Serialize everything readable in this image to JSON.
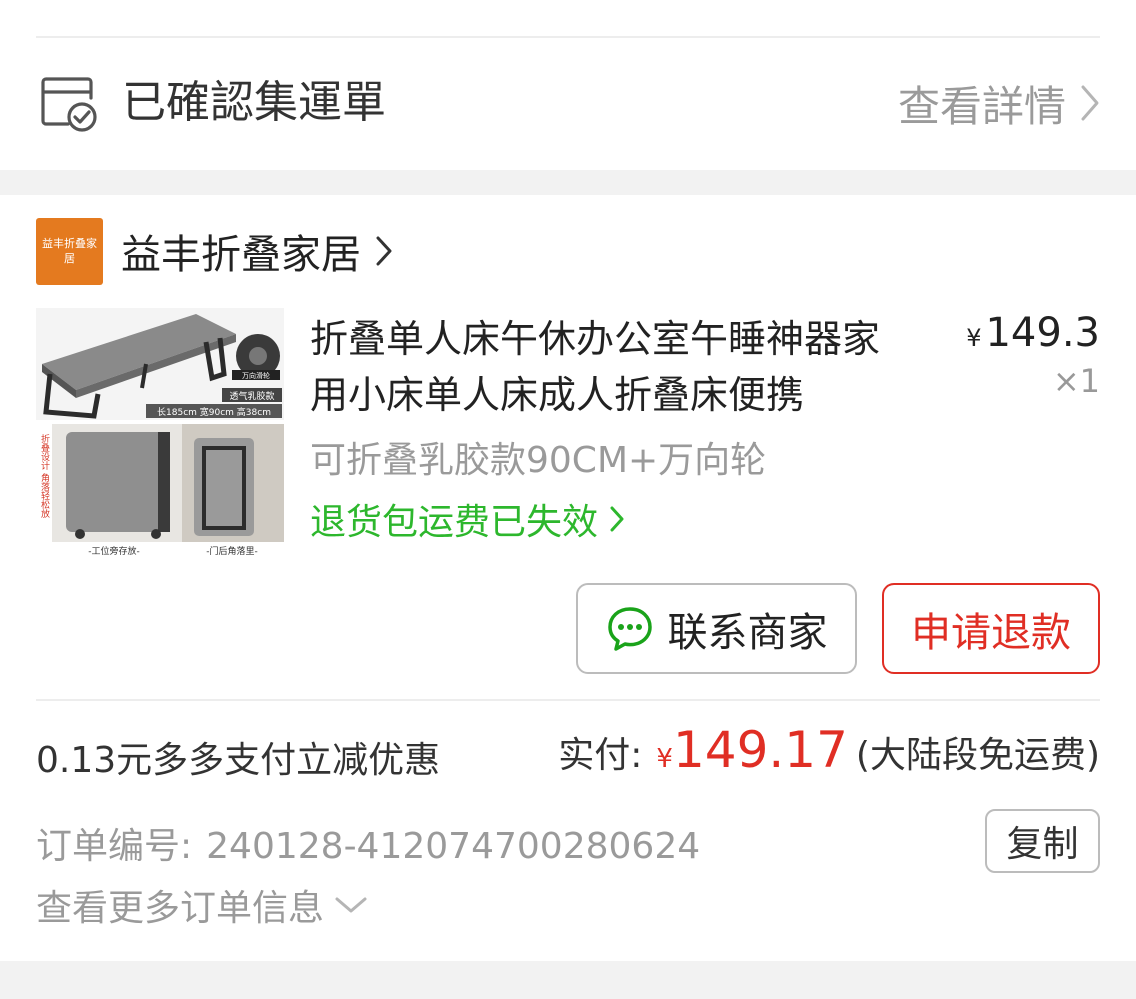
{
  "consolidation": {
    "status_label": "已確認集運單",
    "details_link": "查看詳情",
    "icon": "document-check-icon"
  },
  "store": {
    "logo_text": "益丰折叠家居",
    "name": "益丰折叠家居",
    "logo_color": "#e47a1f"
  },
  "product": {
    "title": "折叠单人床午休办公室午睡神器家用小床单人床成人折叠床便携",
    "price_symbol": "¥",
    "price": "149.3",
    "quantity": "×1",
    "sku": "可折叠乳胶款90CM+万向轮",
    "return_shipping": "退货包运费已失效",
    "image_labels": {
      "feature_badge": "透气乳胶款",
      "dimensions": "长185cm 宽90cm 高38cm",
      "caster_label": "万向滑轮",
      "side_text": "折叠设计 角落轻松放",
      "caption_left": "-工位旁存放-",
      "caption_right": "-门后角落里-"
    }
  },
  "actions": {
    "contact_label": "联系商家",
    "refund_label": "申请退款",
    "chat_icon": "chat-bubble-icon"
  },
  "payment": {
    "discount_text": "0.13元多多支付立减优惠",
    "paid_label": "实付:",
    "paid_symbol": "¥",
    "paid_amount": "149.17",
    "paid_note": "(大陆段免运费)"
  },
  "order": {
    "number_label": "订单编号:",
    "number": "240128-412074700280624",
    "copy_label": "复制",
    "more_info": "查看更多订单信息"
  },
  "colors": {
    "accent_red": "#e02e24",
    "accent_green": "#2db72d",
    "text_gray": "#9a9a9a",
    "background": "#f2f2f2"
  }
}
